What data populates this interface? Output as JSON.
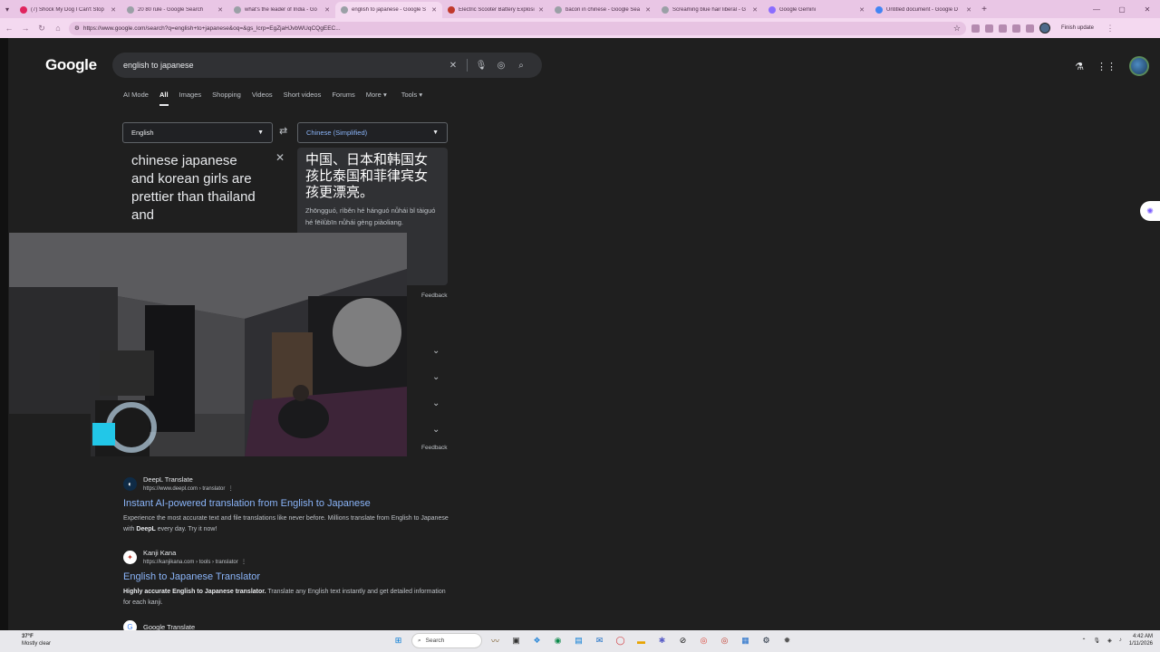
{
  "browser": {
    "tabs": [
      {
        "title": "(7) Shock My Dog I Can't Stop",
        "color": "#e0245e",
        "active": false
      },
      {
        "title": "20 80 rule - Google Search",
        "color": "#9aa0a6",
        "active": false
      },
      {
        "title": "what's the leader of India - Go",
        "color": "#9aa0a6",
        "active": false
      },
      {
        "title": "english to japanese - Google S",
        "color": "#9aa0a6",
        "active": true
      },
      {
        "title": "Electric Scooter Battery Explosi",
        "color": "#c0392b",
        "active": false
      },
      {
        "title": "bacon in chinese - Google Sea",
        "color": "#9aa0a6",
        "active": false
      },
      {
        "title": "Screaming blue hair liberal - G",
        "color": "#9aa0a6",
        "active": false
      },
      {
        "title": "Google Gemini",
        "color": "#8a6cff",
        "active": false
      },
      {
        "title": "Untitled document - Google D",
        "color": "#4285f4",
        "active": false
      }
    ],
    "url": "https://www.google.com/search?q=english+to+japanese&oq=&gs_lcrp=EgZjaHJvbWUqCQgEEC...",
    "update_label": "Finish update"
  },
  "google": {
    "logo": "Google",
    "query": "english to japanese",
    "nav_tabs": [
      "AI Mode",
      "All",
      "Images",
      "Shopping",
      "Videos",
      "Short videos",
      "Forums",
      "More"
    ],
    "tools_label": "Tools",
    "active_tab": "All"
  },
  "translate": {
    "source_lang": "English",
    "target_lang": "Chinese (Simplified)",
    "source_text": "chinese japanese and korean girls are prettier than thailand and",
    "target_text": "中国、日本和韩国女孩比泰国和菲律宾女孩更漂亮。",
    "pinyin": "Zhōngguó, rìběn hé hánguó nǚhái bǐ tàiguó hé fēilǜbīn nǚhái gèng piàoliang.",
    "feedback_label": "Feedback"
  },
  "results": [
    {
      "site": "DeepL Translate",
      "url": "https://www.deepl.com › translator",
      "title": "Instant AI-powered translation from English to Japanese",
      "snippet_pre": "Experience the most accurate text and file translations like never before. Millions translate from English to Japanese with ",
      "snippet_bold": "DeepL",
      "snippet_post": " every day. Try it now!"
    },
    {
      "site": "Kanji Kana",
      "url": "https://kanjikana.com › tools › translator",
      "title": "English to Japanese Translator",
      "snippet_pre": "",
      "snippet_bold": "Highly accurate English to Japanese translator.",
      "snippet_post": " Translate any English text instantly and get detailed information for each kanji."
    },
    {
      "site": "Google Translate",
      "url": "",
      "title": "",
      "snippet_pre": "",
      "snippet_bold": "",
      "snippet_post": ""
    }
  ],
  "taskbar": {
    "temp": "37°F",
    "weather": "Mostly clear",
    "search_label": "Search",
    "time": "4:42 AM",
    "date": "1/11/2026"
  }
}
